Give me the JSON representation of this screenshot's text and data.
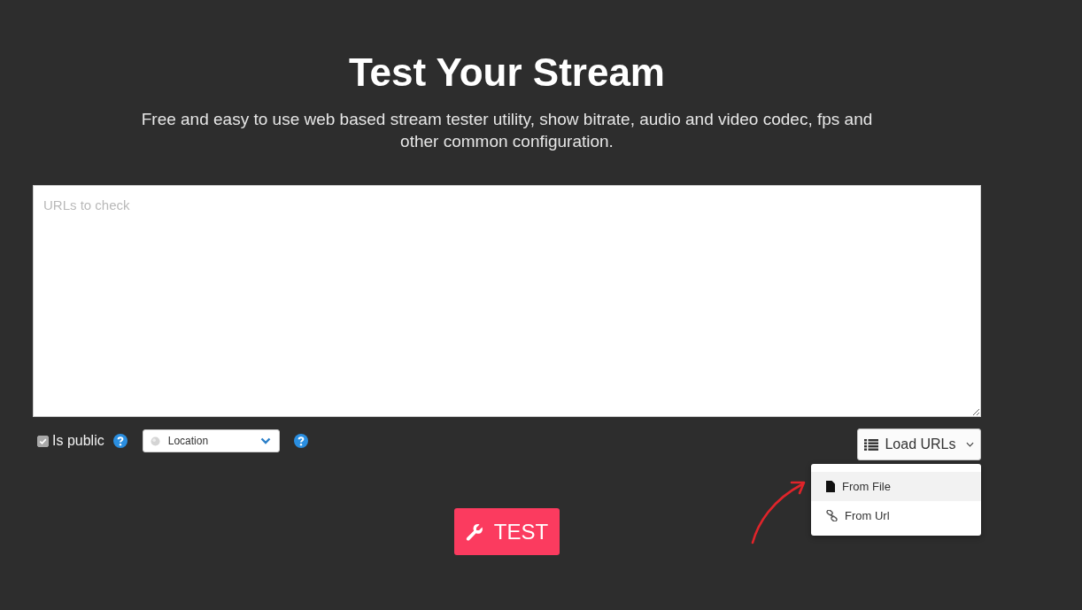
{
  "header": {
    "title": "Test Your Stream",
    "subtitle": "Free and easy to use web based stream tester utility, show bitrate, audio and video codec, fps and other common configuration."
  },
  "urls_field": {
    "placeholder": "URLs to check"
  },
  "options": {
    "is_public": {
      "label": "Is public",
      "checked": true,
      "disabled": true
    },
    "location": {
      "value": "Location"
    }
  },
  "load_urls": {
    "label": "Load URLs",
    "expanded": true,
    "items": [
      {
        "label": "From File",
        "kind": "file",
        "selected": true
      },
      {
        "label": "From Url",
        "kind": "link",
        "selected": false
      }
    ]
  },
  "test_button": {
    "label": "TEST"
  }
}
